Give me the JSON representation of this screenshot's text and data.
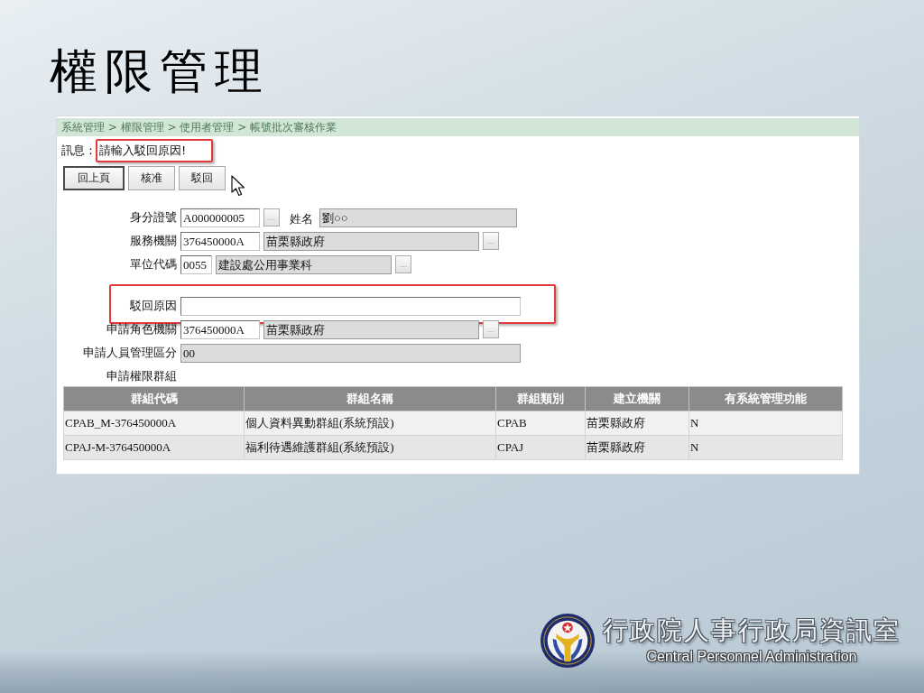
{
  "slide": {
    "title": "權限管理"
  },
  "breadcrumb": "系統管理 > 權限管理 > 使用者管理 > 帳號批次審核作業",
  "message": {
    "label": "訊息：",
    "text": "請輸入駁回原因!",
    "highlighted": true
  },
  "buttons": [
    {
      "label": "回上頁",
      "default": true
    },
    {
      "label": "核准",
      "default": false
    },
    {
      "label": "駁回",
      "default": false
    }
  ],
  "form": {
    "rows": [
      {
        "label": "身分證號",
        "highlighted": false,
        "controls": [
          {
            "kind": "input",
            "value": "A000000005"
          },
          {
            "kind": "lookup",
            "label": "..."
          },
          {
            "kind": "caption",
            "text": "姓名"
          },
          {
            "kind": "readonly",
            "value": "劉○○"
          }
        ]
      },
      {
        "label": "服務機關",
        "highlighted": false,
        "controls": [
          {
            "kind": "input",
            "value": "376450000A"
          },
          {
            "kind": "readonly",
            "value": "苗栗縣政府"
          },
          {
            "kind": "lookup",
            "label": "..."
          }
        ]
      },
      {
        "label": "單位代碼",
        "highlighted": false,
        "controls": [
          {
            "kind": "input",
            "value": "0055"
          },
          {
            "kind": "readonly",
            "value": "建設處公用事業科"
          },
          {
            "kind": "lookup",
            "label": "..."
          }
        ]
      },
      {
        "label": "駁回原因",
        "highlighted": true,
        "controls": [
          {
            "kind": "input"
          }
        ]
      },
      {
        "label": "申請角色機關",
        "highlighted": false,
        "controls": [
          {
            "kind": "input",
            "value": "376450000A"
          },
          {
            "kind": "readonly",
            "value": "苗栗縣政府"
          },
          {
            "kind": "lookup",
            "label": "..."
          }
        ]
      },
      {
        "label": "申請人員管理區分",
        "highlighted": false,
        "controls": [
          {
            "kind": "readonly",
            "value": "00"
          }
        ]
      },
      {
        "label": "申請權限群組",
        "highlighted": false
      }
    ]
  },
  "table": {
    "columns": [
      "群組代碼",
      "群組名稱",
      "群組類別",
      "建立機關",
      "有系統管理功能"
    ],
    "rows": [
      [
        "CPAB_M-376450000A",
        "個人資料異動群組(系統預設)",
        "CPAB",
        "苗栗縣政府",
        "N"
      ],
      [
        "CPAJ-M-376450000A",
        "福利待遇維護群組(系統預設)",
        "CPAJ",
        "苗栗縣政府",
        "N"
      ]
    ]
  },
  "footer": {
    "org_name": "行政院人事行政局資訊室",
    "org_name_en": "Central Personnel Administration"
  }
}
